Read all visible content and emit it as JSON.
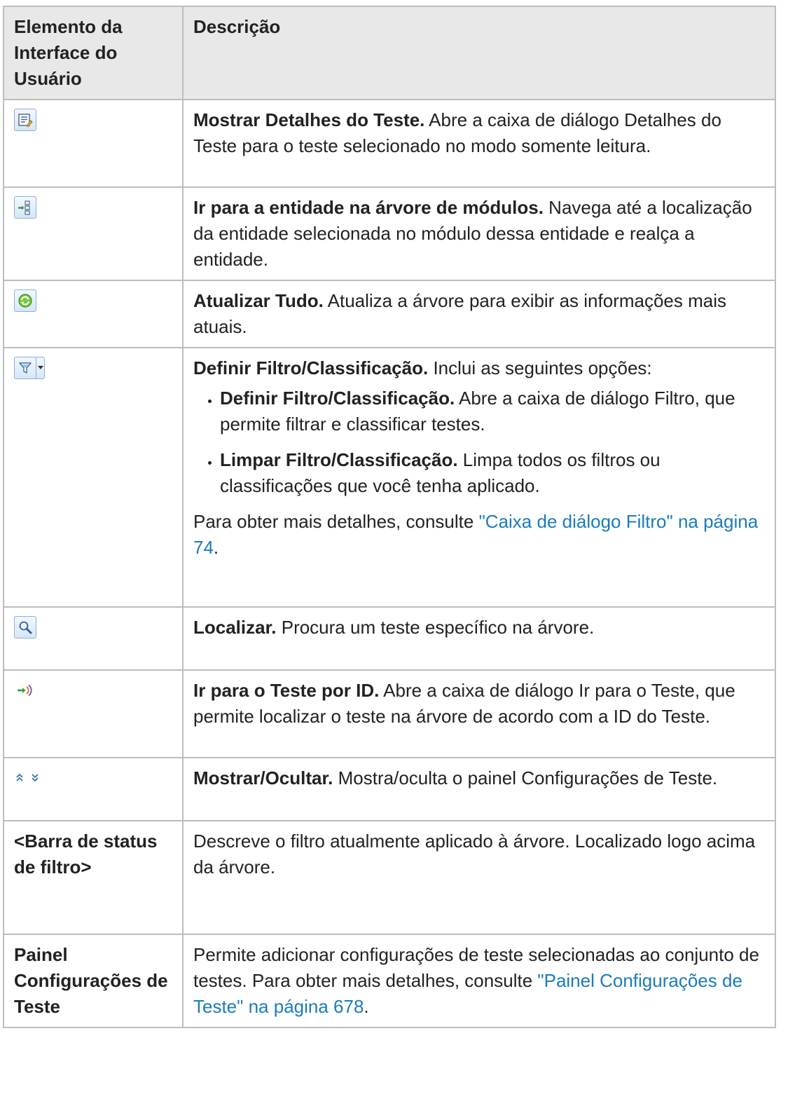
{
  "header": {
    "col1": "Elemento da Interface do Usuário",
    "col2": "Descrição"
  },
  "rows": [
    {
      "icon": "show-test-details-icon",
      "term": "Mostrar Detalhes do Teste.",
      "text": " Abre a caixa de diálogo Detalhes do Teste para o teste selecionado no modo somente leitura."
    },
    {
      "icon": "go-to-module-tree-icon",
      "term": "Ir para a entidade na árvore de módulos.",
      "text": " Navega até a localização da entidade selecionada no módulo dessa entidade e realça a entidade."
    },
    {
      "icon": "refresh-icon",
      "term": "Atualizar Tudo.",
      "text": " Atualiza a árvore para exibir as informações mais atuais."
    },
    {
      "icon": "filter-icon",
      "term": "Definir Filtro/Classificação.",
      "text": "  Inclui as seguintes opções:",
      "options": [
        {
          "term": "Definir Filtro/Classificação.",
          "text": " Abre a caixa de diálogo Filtro, que permite filtrar e classificar testes."
        },
        {
          "term": "Limpar Filtro/Classificação.",
          "text": " Limpa todos os filtros ou classificações que você tenha aplicado."
        }
      ],
      "after_text": "Para obter mais detalhes, consulte ",
      "after_link": "\"Caixa de diálogo Filtro\" na página 74",
      "after_end": "."
    },
    {
      "icon": "find-icon",
      "term": "Localizar.",
      "text": " Procura um teste específico na árvore."
    },
    {
      "icon": "go-to-test-by-id-icon",
      "term": "Ir para o Teste por ID.",
      "text": " Abre a caixa de diálogo Ir para o Teste, que permite localizar o teste na árvore de acordo com a ID do Teste."
    },
    {
      "icon": "show-hide-icon",
      "term": "Mostrar/Ocultar.",
      "text": " Mostra/oculta o painel Configurações de Teste."
    },
    {
      "label": "<Barra de status de filtro>",
      "text": "Descreve o filtro atualmente aplicado à árvore. Localizado logo acima da árvore."
    },
    {
      "label": "Painel Configurações de Teste",
      "text": "Permite adicionar configurações de teste selecionadas ao conjunto de testes. Para obter mais detalhes, consulte ",
      "link": "\"Painel Configurações de Teste\" na página 678",
      "end": "."
    }
  ],
  "colors": {
    "link": "#1a7bbd",
    "header_bg": "#e8e8e8",
    "border": "#bdbdbd"
  }
}
